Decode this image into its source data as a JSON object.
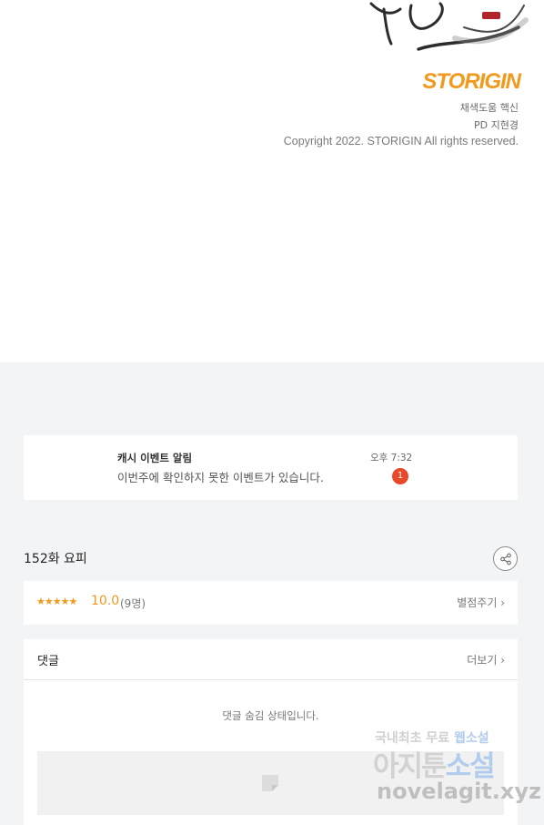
{
  "credits": {
    "brand": "STORIGIN",
    "line1": "채색도움  핵신",
    "line2": "PD      지현경",
    "copyright": "Copyright 2022. STORIGIN All rights reserved."
  },
  "notification": {
    "title": "캐시 이벤트 알림",
    "body": "이번주에 확인하지 못한 이벤트가 있습니다.",
    "time": "오후 7:32",
    "badge_count": "1"
  },
  "episode": {
    "title": "152화 요피"
  },
  "rating": {
    "stars": "★★★★★",
    "score": "10.0",
    "count": "(9명)",
    "rate_label": "별점주기 ›"
  },
  "comments": {
    "label": "댓글",
    "more_label": "더보기 ›",
    "hidden_message": "댓글 숨김 상태입니다."
  },
  "watermark": {
    "line1_a": "국내최초 무료",
    "line1_b": "웹소설",
    "line2_a": "아지툰",
    "line2_b": "소설",
    "line3": "novelagit.xyz"
  },
  "colors": {
    "accent_orange": "#f29a1d",
    "badge_red": "#e8492a",
    "page_gray": "#f3f4f5"
  }
}
